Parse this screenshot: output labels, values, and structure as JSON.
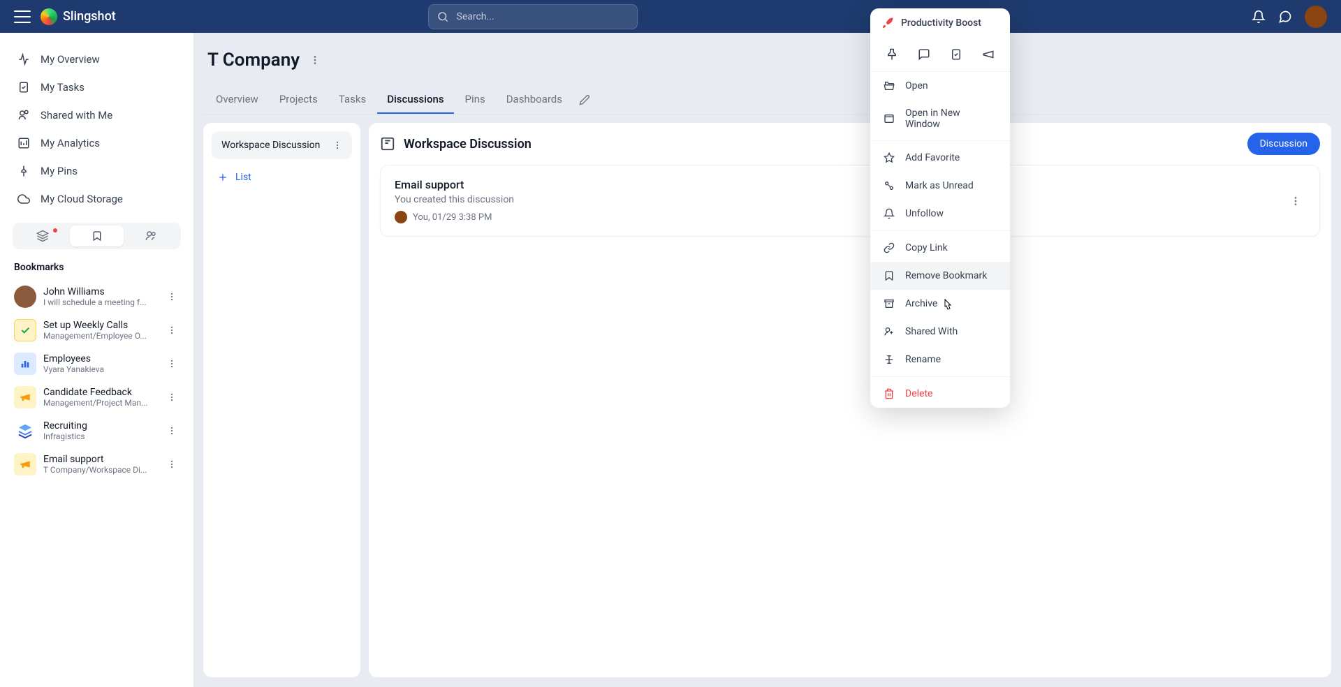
{
  "app": {
    "name": "Slingshot",
    "search_placeholder": "Search..."
  },
  "sidebar": {
    "nav": [
      {
        "label": "My Overview"
      },
      {
        "label": "My Tasks"
      },
      {
        "label": "Shared with Me"
      },
      {
        "label": "My Analytics"
      },
      {
        "label": "My Pins"
      },
      {
        "label": "My Cloud Storage"
      }
    ],
    "bookmarks_title": "Bookmarks",
    "bookmarks": [
      {
        "title": "John Williams",
        "sub": "I will schedule a meeting f..."
      },
      {
        "title": "Set up Weekly Calls",
        "sub": "Management/Employee O..."
      },
      {
        "title": "Employees",
        "sub": "Vyara Yanakieva"
      },
      {
        "title": "Candidate Feedback",
        "sub": "Management/Project Man..."
      },
      {
        "title": "Recruiting",
        "sub": "Infragistics"
      },
      {
        "title": "Email support",
        "sub": "T Company/Workspace Di..."
      }
    ]
  },
  "workspace": {
    "title": "T Company",
    "tabs": [
      "Overview",
      "Projects",
      "Tasks",
      "Discussions",
      "Pins",
      "Dashboards"
    ],
    "active_tab": 3,
    "left_panel": {
      "item": "Workspace Discussion",
      "add_label": "List"
    },
    "right_panel": {
      "title": "Workspace Discussion",
      "button": "Discussion",
      "discussion": {
        "title": "Email support",
        "sub": "You created this discussion",
        "meta": "You, 01/29 3:38 PM"
      }
    }
  },
  "context_menu": {
    "header": "Productivity Boost",
    "items": [
      "Open",
      "Open in New Window",
      "Add Favorite",
      "Mark as Unread",
      "Unfollow",
      "Copy Link",
      "Remove Bookmark",
      "Archive",
      "Shared With",
      "Rename",
      "Delete"
    ]
  }
}
